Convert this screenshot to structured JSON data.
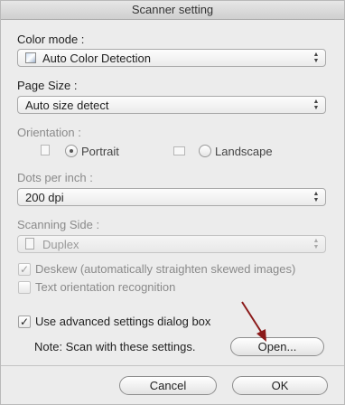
{
  "window": {
    "title": "Scanner setting"
  },
  "color_mode": {
    "label": "Color mode :",
    "value": "Auto Color Detection",
    "icon": "color-detect-icon"
  },
  "page_size": {
    "label": "Page Size :",
    "value": "Auto size detect"
  },
  "orientation": {
    "label": "Orientation :",
    "options": [
      {
        "label": "Portrait",
        "selected": true
      },
      {
        "label": "Landscape",
        "selected": false
      }
    ]
  },
  "dpi": {
    "label": "Dots per inch :",
    "value": "200 dpi"
  },
  "scanning_side": {
    "label": "Scanning Side :",
    "value": "Duplex",
    "icon": "duplex-page-icon",
    "enabled": false
  },
  "options": {
    "deskew": {
      "label": "Deskew (automatically straighten skewed images)",
      "checked": true,
      "enabled": false
    },
    "text_orientation": {
      "label": "Text orientation recognition",
      "checked": false,
      "enabled": false
    }
  },
  "advanced": {
    "label": "Use advanced settings dialog box",
    "checked": true,
    "note": "Note: Scan with these settings.",
    "open_label": "Open..."
  },
  "footer": {
    "cancel_label": "Cancel",
    "ok_label": "OK"
  },
  "annotation": {
    "arrow_color": "#8b1a1a"
  }
}
